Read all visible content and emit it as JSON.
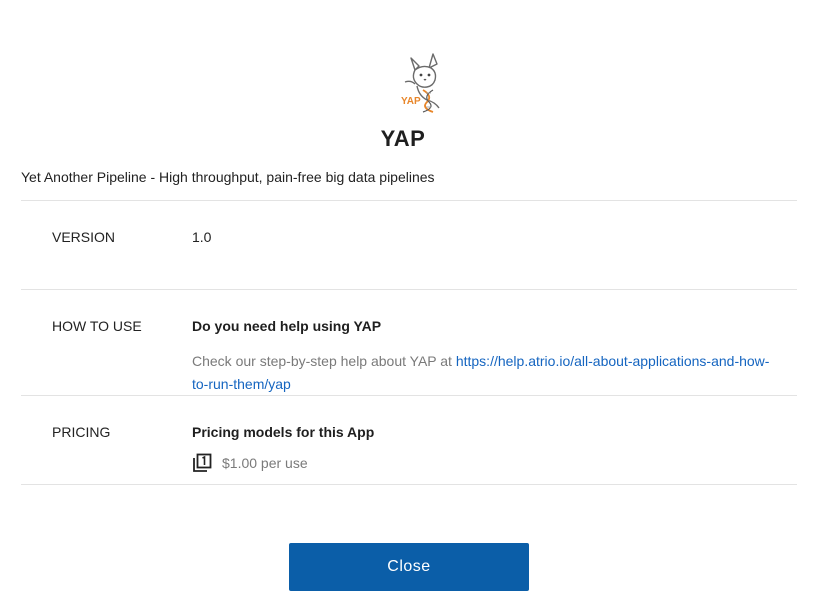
{
  "app": {
    "logo_text": "YAP",
    "title": "YAP",
    "description": "Yet Another Pipeline - High throughput, pain-free big data pipelines"
  },
  "version": {
    "label": "VERSION",
    "value": "1.0"
  },
  "how_to_use": {
    "label": "HOW TO USE",
    "heading": "Do you need help using YAP",
    "text": "Check our step-by-step help about YAP at ",
    "link": "https://help.atrio.io/all-about-applications-and-how-to-run-them/yap"
  },
  "pricing": {
    "label": "PRICING",
    "heading": "Pricing models for this App",
    "icon": "filter-1-icon",
    "price": "$1.00 per use"
  },
  "actions": {
    "close_label": "Close"
  },
  "colors": {
    "primary_button": "#0b5ea8",
    "link": "#1565c0",
    "logo_orange": "#e8862a",
    "muted_text": "#7a7a7a"
  }
}
